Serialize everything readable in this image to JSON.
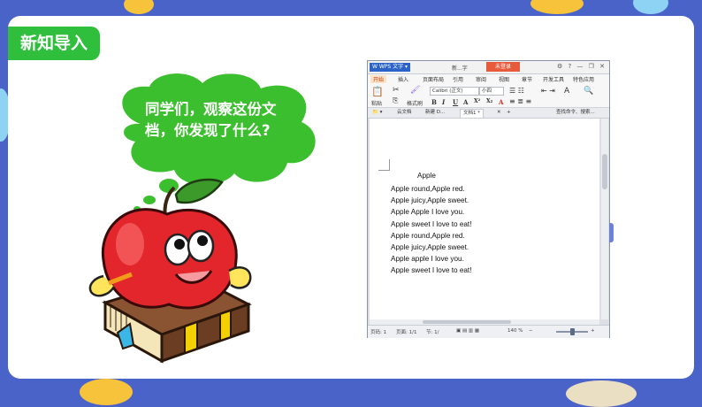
{
  "slide": {
    "title_tag": "新知导入",
    "bubble_text": "同学们，观察这份文档，你发现了什么?"
  },
  "wps": {
    "app_logo": "W WPS 文字 ▾",
    "doc_name": "新...字",
    "login_button": "未登录",
    "menu": [
      "开始",
      "插入",
      "页面布局",
      "引用",
      "审阅",
      "视图",
      "章节",
      "开发工具",
      "特色应用"
    ],
    "active_menu": 0,
    "ribbon": {
      "paste": "粘贴",
      "format_painter": "格式刷",
      "font_name": "Calibri (正文)",
      "font_size": "小四",
      "format_buttons": [
        "B",
        "I",
        "U",
        "A",
        "X²",
        "X₂",
        "A"
      ]
    },
    "tabs": [
      "云文档",
      "新建 D...",
      "文档1 *"
    ],
    "tab_search": "查找命令、搜索...",
    "document": {
      "title": "Apple",
      "lines": [
        "Apple round,Apple red.",
        "Apple juicy,Apple sweet.",
        "Apple Apple I love you.",
        "Apple sweet I love to eat!",
        "Apple round,Apple red.",
        "Apple juicy,Apple sweet.",
        "Apple apple I love you.",
        "Apple sweet I love to eat!"
      ]
    },
    "status": {
      "page": "页码: 1",
      "pages": "页面: 1/1",
      "section": "节: 1/",
      "zoom": "140 %",
      "zoom_level": 0.5
    }
  },
  "colors": {
    "background": "#4a63c9",
    "title_tag": "#2fbf3c",
    "bubble": "#3cbf2e",
    "apple": "#e2262c",
    "book": "#6b3e23",
    "wps_accent": "#2b63c7"
  }
}
